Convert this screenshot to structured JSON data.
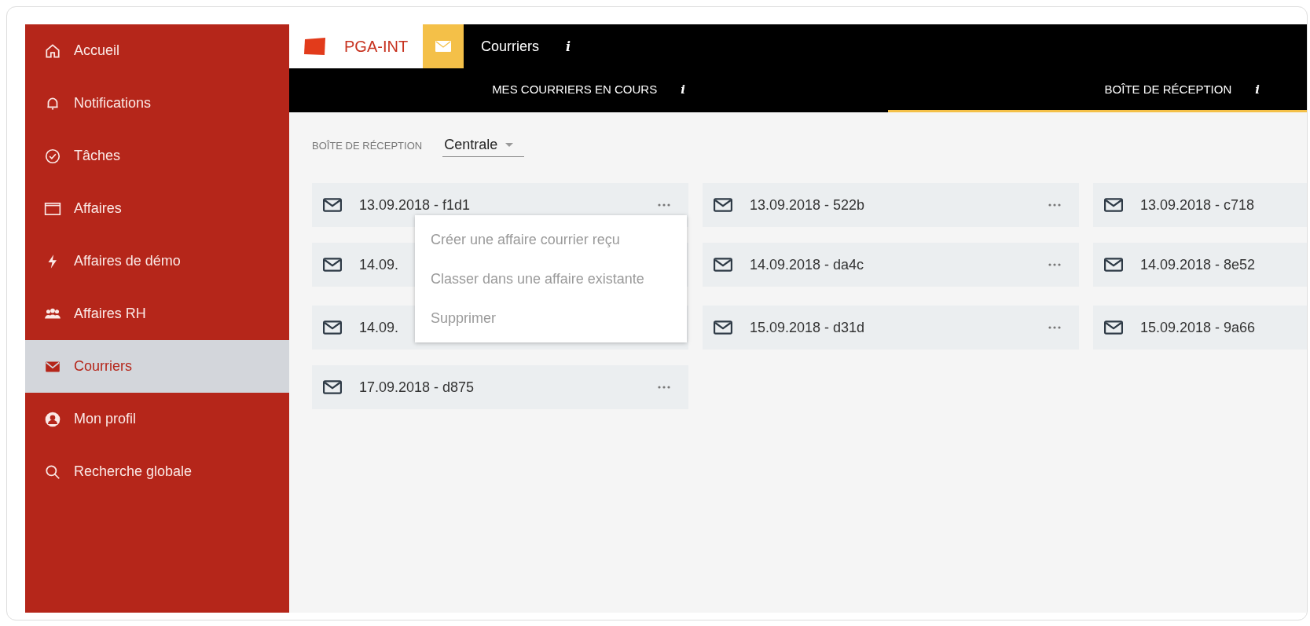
{
  "sidebar": {
    "items": [
      {
        "label": "Accueil",
        "selected": false
      },
      {
        "label": "Notifications",
        "selected": false
      },
      {
        "label": "Tâches",
        "selected": false
      },
      {
        "label": "Affaires",
        "selected": false
      },
      {
        "label": "Affaires de démo",
        "selected": false
      },
      {
        "label": "Affaires RH",
        "selected": false
      },
      {
        "label": "Courriers",
        "selected": true
      },
      {
        "label": "Mon profil",
        "selected": false
      },
      {
        "label": "Recherche globale",
        "selected": false
      }
    ]
  },
  "header": {
    "brand": "PGA-INT",
    "title": "Courriers",
    "info": "i"
  },
  "tabs": [
    {
      "label": "MES COURRIERS EN COURS",
      "info": "i",
      "selected": false
    },
    {
      "label": "BOÎTE DE RÉCEPTION",
      "info": "i",
      "selected": true
    }
  ],
  "filter": {
    "label": "BOÎTE DE RÉCEPTION",
    "value": "Centrale"
  },
  "cards": [
    [
      {
        "title": "13.09.2018 - f1d1"
      },
      {
        "title": "13.09.2018 - 522b"
      },
      {
        "title": "13.09.2018 - c718"
      }
    ],
    [
      {
        "title": "14.09."
      },
      {
        "title": "14.09.2018 - da4c"
      },
      {
        "title": "14.09.2018 - 8e52"
      }
    ],
    [
      {
        "title": "14.09."
      },
      {
        "title": "15.09.2018 - d31d"
      },
      {
        "title": "15.09.2018 - 9a66"
      }
    ],
    [
      {
        "title": "17.09.2018 - d875"
      }
    ]
  ],
  "context_menu": {
    "items": [
      {
        "label": "Créer une affaire courrier reçu",
        "disabled": true
      },
      {
        "label": "Classer dans une affaire existante",
        "disabled": true
      },
      {
        "label": "Supprimer",
        "disabled": true
      }
    ]
  }
}
